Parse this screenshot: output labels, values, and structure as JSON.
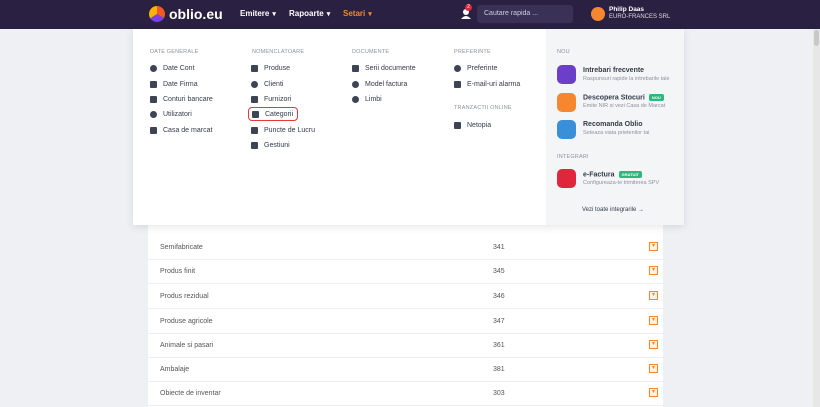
{
  "header": {
    "logo_text": "oblio.eu",
    "nav": [
      {
        "label": "Emitere",
        "active": false
      },
      {
        "label": "Rapoarte",
        "active": false
      },
      {
        "label": "Setari",
        "active": true
      }
    ],
    "notification_count": "2",
    "search_placeholder": "Cautare rapida ...",
    "user_name": "Philip Daas",
    "user_company": "EURO-FRANCES SRL"
  },
  "menu": {
    "columns": [
      {
        "title": "DATE GENERALE",
        "items": [
          {
            "label": "Date Cont",
            "icon": "user-icon"
          },
          {
            "label": "Date Firma",
            "icon": "building-icon"
          },
          {
            "label": "Conturi bancare",
            "icon": "bank-icon"
          },
          {
            "label": "Utilizatori",
            "icon": "users-icon"
          },
          {
            "label": "Casa de marcat",
            "icon": "register-icon"
          }
        ]
      },
      {
        "title": "NOMENCLATOARE",
        "items": [
          {
            "label": "Produse",
            "icon": "box-icon"
          },
          {
            "label": "Clienti",
            "icon": "client-icon"
          },
          {
            "label": "Furnizori",
            "icon": "truck-icon"
          },
          {
            "label": "Categorii",
            "icon": "list-icon",
            "highlighted": true
          },
          {
            "label": "Puncte de Lucru",
            "icon": "grid-icon"
          },
          {
            "label": "Gestiuni",
            "icon": "layers-icon"
          }
        ]
      },
      {
        "title": "DOCUMENTE",
        "items": [
          {
            "label": "Serii documente",
            "icon": "document-icon"
          },
          {
            "label": "Model factura",
            "icon": "palette-icon"
          },
          {
            "label": "Limbi",
            "icon": "globe-icon"
          }
        ]
      },
      {
        "title": "PREFERINTE",
        "items": [
          {
            "label": "Preferinte",
            "icon": "gear-icon"
          },
          {
            "label": "E-mail-uri alarma",
            "icon": "mail-icon"
          }
        ]
      },
      {
        "title": "TRANZACTII ONLINE",
        "items": [
          {
            "label": "Netopia",
            "icon": "card-icon"
          }
        ]
      }
    ],
    "nou": {
      "title": "NOU",
      "cards": [
        {
          "title": "Intrebari frecvente",
          "subtitle": "Raspunsuri rapide la intrebarile tale",
          "color": "#6c3fc9",
          "icon": "question-icon",
          "tag": ""
        },
        {
          "title": "Descopera Stocuri",
          "subtitle": "Emite NIR si vezi Casa de Marcat",
          "color": "#f7872e",
          "icon": "boxes-icon",
          "tag": "NOU"
        },
        {
          "title": "Recomanda Oblio",
          "subtitle": "Seteaza viata prietenilor tai",
          "color": "#3a8fd9",
          "icon": "share-icon",
          "tag": ""
        }
      ]
    },
    "integrari": {
      "title": "INTEGRARI",
      "cards": [
        {
          "title": "e-Factura",
          "subtitle": "Configureaza-te trimiterea SPV",
          "color": "#e0263c",
          "icon": "clipboard-icon",
          "tag": "GRATUIT"
        }
      ],
      "view_all": "Vezi toate integrarile  →"
    }
  },
  "table": {
    "rows": [
      {
        "name": "Semifabricate",
        "code": "341"
      },
      {
        "name": "Produs finit",
        "code": "345"
      },
      {
        "name": "Produs rezidual",
        "code": "346"
      },
      {
        "name": "Produse agricole",
        "code": "347"
      },
      {
        "name": "Animale si pasari",
        "code": "361"
      },
      {
        "name": "Ambalaje",
        "code": "381"
      },
      {
        "name": "Obiecte de inventar",
        "code": "303"
      }
    ]
  },
  "colors": {
    "header_bg": "#2a2142",
    "accent": "#f7872e",
    "highlight": "#e53935"
  }
}
